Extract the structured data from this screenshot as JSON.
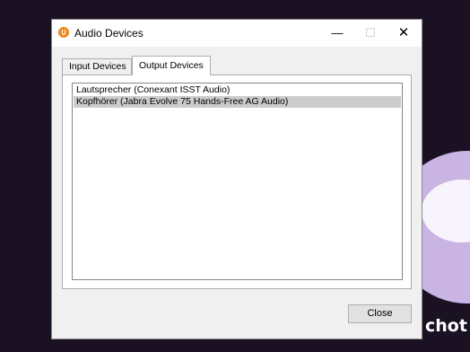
{
  "desktop": {
    "background_text": "chot"
  },
  "window": {
    "title": "Audio Devices",
    "controls": {
      "minimize": "—",
      "maximize": "☐",
      "close": "✕"
    }
  },
  "tabs": [
    {
      "label": "Input Devices",
      "selected": false
    },
    {
      "label": "Output Devices",
      "selected": true
    }
  ],
  "devices": [
    {
      "label": "Lautsprecher (Conexant ISST Audio)",
      "selected": false
    },
    {
      "label": "Kopfhörer (Jabra Evolve 75 Hands-Free AG Audio)",
      "selected": true
    }
  ],
  "buttons": {
    "close_label": "Close"
  },
  "colors": {
    "app_icon": "#f08a1c",
    "selection": "#cccccc"
  }
}
